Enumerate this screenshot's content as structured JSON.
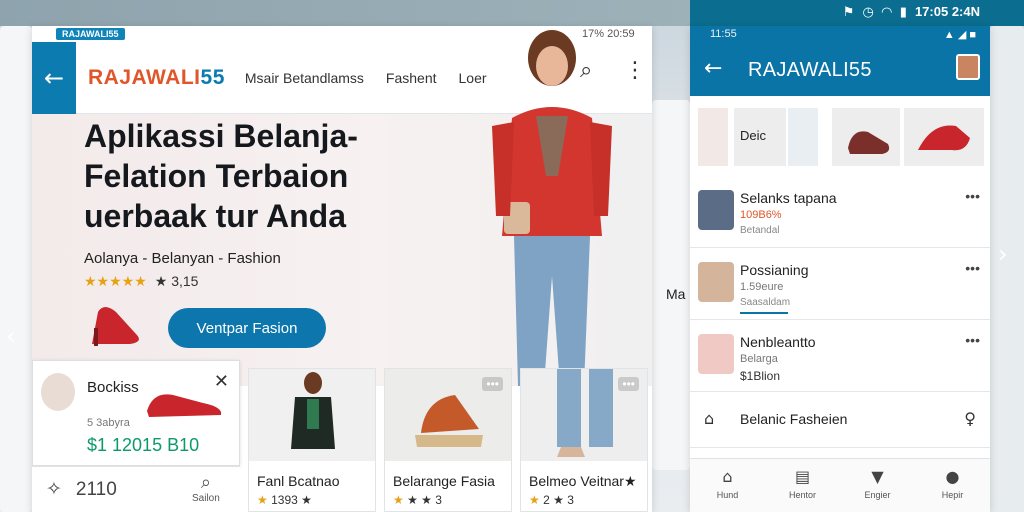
{
  "status_right": "17:05 2:4N",
  "left_app": {
    "mini_badge": "RAJAWALI55",
    "mini_status": "17% 20:59",
    "brand_part1": "RAJAWALI",
    "brand_part2": "55",
    "nav": [
      "Msair Betandlamss",
      "Fashent",
      "Loer"
    ],
    "hero": {
      "title_line1": "Aplikassi Belanja-",
      "title_line2": "Felation Terbaion",
      "title_line3": "uerbaak tur Anda",
      "subtitle": "Aolanya - Belanyan - Fashion",
      "stars": "★★★★★",
      "rating": "★ 3,15",
      "cta": "Ventpar Fasion"
    },
    "popup": {
      "title": "Bockiss",
      "sub": "5 3abyra",
      "price": "$1 12015 B10"
    },
    "bottom": {
      "count": "2110",
      "search_label": "Sailon"
    },
    "cards": [
      {
        "name": "Fanl Bcatnao",
        "rating": "1393 ★"
      },
      {
        "name": "Belarange Fasia",
        "rating": "★ ★ 3"
      },
      {
        "name": "Belmeo Veitnar★",
        "rating": "2 ★ 3"
      }
    ],
    "edge_text": "Ma"
  },
  "right_app": {
    "status_left": "11:55",
    "status_right": "▲ ◢ ■",
    "title": "RAJAWALI55",
    "thumb_label": "Deic",
    "items": [
      {
        "name": "Selanks tapana",
        "l2": "109B6%",
        "l3": "Betandal"
      },
      {
        "name": "Possianing",
        "l2": "1.59eure",
        "l3": "Saasaldam"
      },
      {
        "name": "Nenbleantto",
        "l2": "Belarga",
        "l3": "$1Blion"
      }
    ],
    "row_label": "Belanic Fasheien",
    "tabs": [
      "Hund",
      "Hentor",
      "Engier",
      "Hepir"
    ]
  },
  "colors": {
    "accent": "#0b74a6",
    "brand_orange": "#e0562a",
    "star": "#e6a117"
  }
}
